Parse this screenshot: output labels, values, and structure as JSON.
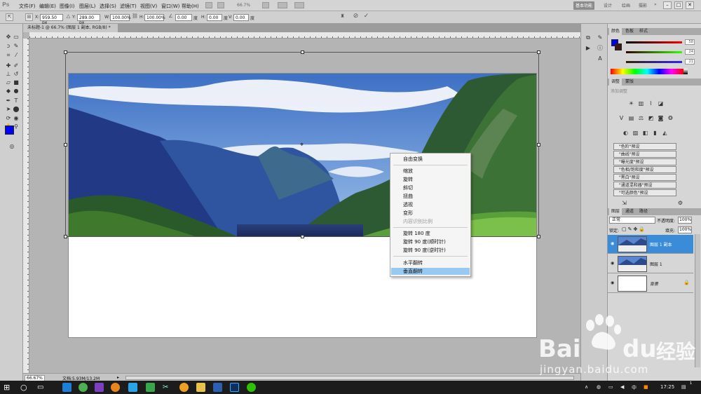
{
  "menubar": {
    "logo": "Ps",
    "items": [
      "文件(F)",
      "编辑(E)",
      "图像(I)",
      "图层(L)",
      "选择(S)",
      "滤镜(T)",
      "视图(V)",
      "窗口(W)",
      "帮助(H)"
    ],
    "zoom_value": "66.7%",
    "workspaces": [
      "基本功能",
      "设计",
      "绘画",
      "摄影"
    ],
    "workspace_more": "»",
    "window_controls": [
      "–",
      "□",
      "✕"
    ]
  },
  "options": {
    "x_label": "X:",
    "x_value": "959.50 px",
    "y_label": "Y:",
    "y_value": "289.00 px",
    "w_label": "W:",
    "w_value": "100.00%",
    "h_label": "H:",
    "h_value": "100.00%",
    "angle_value": "0.00",
    "angle_unit": "度",
    "hskew_label": "H:",
    "hskew_value": "0.00",
    "hskew_unit": "度",
    "vskew_label": "V:",
    "vskew_value": "0.00",
    "vskew_unit": "度",
    "cancel_icon": "⊘",
    "commit_icon": "✓"
  },
  "document": {
    "tab_title": "未标题-1 @ 66.7% (图层 1 副本, RGB/8) *",
    "tab_close": "×"
  },
  "context_menu": {
    "items": [
      {
        "label": "自由变换",
        "disabled": false,
        "highlighted": false
      },
      {
        "label": "缩放",
        "disabled": false,
        "highlighted": false
      },
      {
        "label": "旋转",
        "disabled": false,
        "highlighted": false
      },
      {
        "label": "斜切",
        "disabled": false,
        "highlighted": false
      },
      {
        "label": "扭曲",
        "disabled": false,
        "highlighted": false
      },
      {
        "label": "透视",
        "disabled": false,
        "highlighted": false
      },
      {
        "label": "变形",
        "disabled": false,
        "highlighted": false
      },
      {
        "label": "内容识别比例",
        "disabled": true,
        "highlighted": false
      },
      {
        "label": "旋转 180 度",
        "disabled": false,
        "highlighted": false
      },
      {
        "label": "旋转 90 度(顺时针)",
        "disabled": false,
        "highlighted": false
      },
      {
        "label": "旋转 90 度(逆时针)",
        "disabled": false,
        "highlighted": false
      },
      {
        "label": "水平翻转",
        "disabled": false,
        "highlighted": false
      },
      {
        "label": "垂直翻转",
        "disabled": false,
        "highlighted": true
      }
    ]
  },
  "status": {
    "zoom": "66.67%",
    "doc_info": "文档:5.93M/13.2M"
  },
  "color_panel": {
    "tabs": [
      "颜色",
      "色板",
      "样式"
    ],
    "r": 58,
    "g": 24,
    "b": 21,
    "foreground": "#0000ff",
    "background": "#3a1815"
  },
  "adjustments_panel": {
    "tabs": [
      "调整",
      "蒙版"
    ],
    "subtitle": "添加调整",
    "presets": [
      "\"色阶\"预设",
      "\"曲线\"预设",
      "\"曝光度\"预设",
      "\"色相/饱和度\"预设",
      "\"黑白\"预设",
      "\"通道混和器\"预设",
      "\"可选颜色\"预设"
    ]
  },
  "layers_panel": {
    "tabs": [
      "图层",
      "通道",
      "路径"
    ],
    "blend_mode": "正常",
    "opacity_label": "不透明度:",
    "opacity_value": "100%",
    "lock_label": "锁定:",
    "fill_label": "填充:",
    "fill_value": "100%",
    "layers": [
      {
        "name": "图层 1 副本",
        "selected": true
      },
      {
        "name": "图层 1",
        "selected": false
      },
      {
        "name": "背景",
        "selected": false
      }
    ]
  },
  "taskbar": {
    "ime": "中",
    "time": "17:25",
    "notification_count": "1"
  },
  "watermark": {
    "brand": "Bai",
    "brand2": "du",
    "brand3": "经验",
    "url": "jingyan.baidu.com"
  },
  "colors": {
    "accent": "#3a8bd8",
    "menu_highlight": "#99c8f0",
    "taskbar": "#1c1c1c"
  }
}
